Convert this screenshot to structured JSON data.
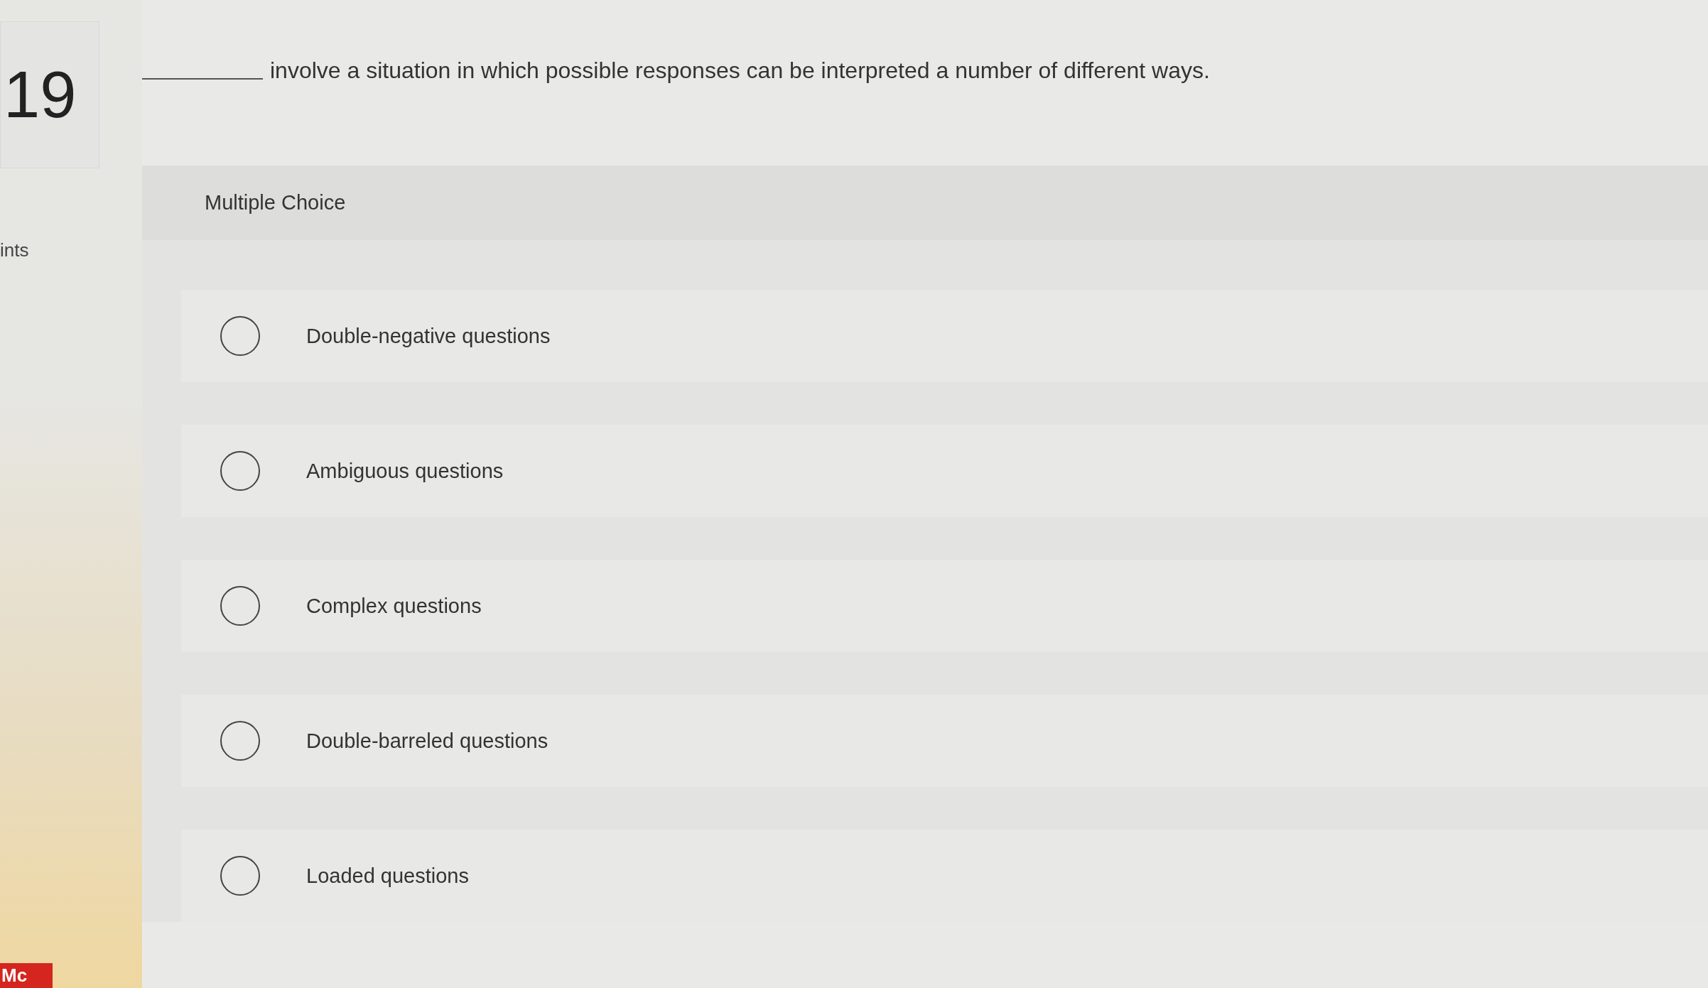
{
  "question": {
    "number": "19",
    "points_label": "ints",
    "text": "involve a situation in which possible responses can be interpreted a number of different ways."
  },
  "answer_panel": {
    "heading": "Multiple Choice",
    "options": [
      {
        "label": "Double-negative questions",
        "selected": false
      },
      {
        "label": "Ambiguous questions",
        "selected": false
      },
      {
        "label": "Complex questions",
        "selected": false
      },
      {
        "label": "Double-barreled questions",
        "selected": false
      },
      {
        "label": "Loaded questions",
        "selected": false
      }
    ]
  },
  "footer": {
    "badge": "Mc"
  }
}
